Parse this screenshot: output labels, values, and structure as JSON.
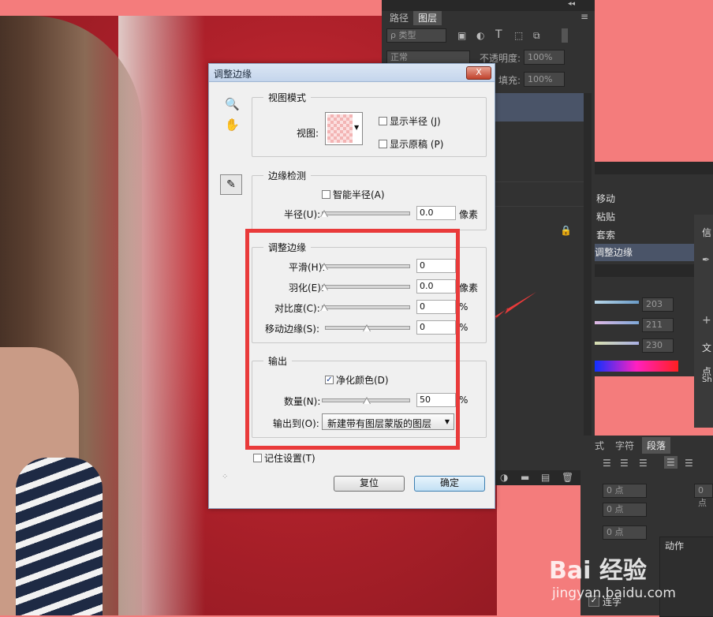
{
  "layers_panel": {
    "tabs": [
      "路径",
      "图层"
    ],
    "filter_label": "ρ 类型",
    "blend_mode": "正常",
    "opacity_label": "不透明度:",
    "opacity_value": "100%",
    "fill_label": "填充:",
    "fill_value": "100%"
  },
  "history_panel": {
    "items": [
      "移动",
      "粘贴",
      "套索",
      "调整边缘"
    ]
  },
  "color_panel": {
    "values": [
      "203",
      "211",
      "230"
    ]
  },
  "side_panel": {
    "items": [
      "信",
      "文",
      "点",
      "Sh"
    ]
  },
  "character_panel": {
    "tabs": [
      "式",
      "字符",
      "段落"
    ],
    "fields": [
      "0 点",
      "0 点",
      "0 点",
      "0 点"
    ],
    "actions_tab": "动作",
    "checkbox_label": "连字"
  },
  "dialog": {
    "title": "调整边缘",
    "close_label": "X",
    "view_mode": {
      "legend": "视图模式",
      "view_label": "视图:",
      "show_radius": "显示半径 (J)",
      "show_original": "显示原稿 (P)"
    },
    "edge_detection": {
      "legend": "边缘检测",
      "smart_radius": "智能半径(A)",
      "radius_label": "半径(U):",
      "radius_value": "0.0",
      "radius_unit": "像素"
    },
    "adjust_edge": {
      "legend": "调整边缘",
      "smooth_label": "平滑(H):",
      "smooth_value": "0",
      "feather_label": "羽化(E):",
      "feather_value": "0.0",
      "feather_unit": "像素",
      "contrast_label": "对比度(C):",
      "contrast_value": "0",
      "shift_label": "移动边缘(S):",
      "shift_value": "0",
      "percent": "%"
    },
    "output": {
      "legend": "输出",
      "decontaminate": "净化颜色(D)",
      "decontaminate_checked": true,
      "amount_label": "数量(N):",
      "amount_value": "50",
      "output_to_label": "输出到(O):",
      "output_to_value": "新建带有图层蒙版的图层"
    },
    "remember_settings": "记住设置(T)",
    "reset_button": "复位",
    "ok_button": "确定"
  },
  "watermark": {
    "brand": "Bai 经验",
    "url": "jingyan.baidu.com"
  },
  "colors": {
    "highlight_box": "#e93a3a",
    "page_bg": "#f47c7c"
  }
}
